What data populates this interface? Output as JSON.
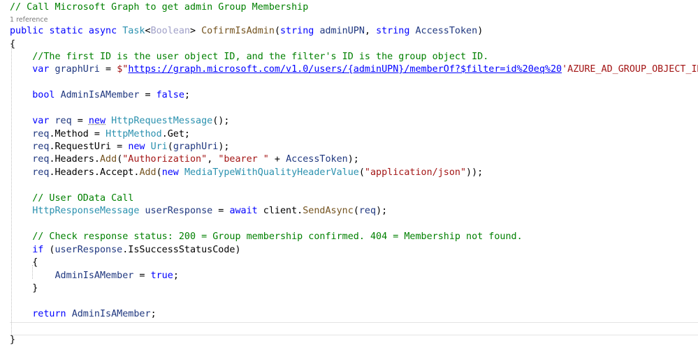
{
  "editor": {
    "codelens": "1 reference",
    "lines": [
      [
        {
          "t": "// Call Microsoft Graph to get admin Group Membership",
          "c": "cm"
        }
      ],
      [
        {
          "t": "public",
          "c": "kw"
        },
        {
          "t": " ",
          "c": "pn"
        },
        {
          "t": "static",
          "c": "kw"
        },
        {
          "t": " ",
          "c": "pn"
        },
        {
          "t": "async",
          "c": "kw"
        },
        {
          "t": " ",
          "c": "pn"
        },
        {
          "t": "Task",
          "c": "ty"
        },
        {
          "t": "<",
          "c": "pn"
        },
        {
          "t": "Boolean",
          "c": "tp"
        },
        {
          "t": "> ",
          "c": "pn"
        },
        {
          "t": "CofirmIsAdmin",
          "c": "mt"
        },
        {
          "t": "(",
          "c": "pn"
        },
        {
          "t": "string",
          "c": "kw"
        },
        {
          "t": " ",
          "c": "pn"
        },
        {
          "t": "adminUPN",
          "c": "vr"
        },
        {
          "t": ", ",
          "c": "pn"
        },
        {
          "t": "string",
          "c": "kw"
        },
        {
          "t": " ",
          "c": "pn"
        },
        {
          "t": "AccessToken",
          "c": "vr"
        },
        {
          "t": ")",
          "c": "pn"
        }
      ],
      [
        {
          "t": "{",
          "c": "pn"
        }
      ],
      [
        {
          "t": "    ",
          "c": "pn"
        },
        {
          "t": "//The first ID is the user object ID, and the filter's ID is the group object ID.",
          "c": "cm"
        }
      ],
      [
        {
          "t": "    ",
          "c": "pn"
        },
        {
          "t": "var",
          "c": "kw"
        },
        {
          "t": " ",
          "c": "pn"
        },
        {
          "t": "graphUri",
          "c": "vr"
        },
        {
          "t": " = ",
          "c": "pn"
        },
        {
          "t": "$\"",
          "c": "st"
        },
        {
          "t": "https://graph.microsoft.com/v1.0/users/{adminUPN}/memberOf?$filter=id%20eq%20",
          "c": "url"
        },
        {
          "t": "'AZURE_AD_GROUP_OBJECT_ID'\"",
          "c": "st"
        },
        {
          "t": ";",
          "c": "pn"
        }
      ],
      [],
      [
        {
          "t": "    ",
          "c": "pn"
        },
        {
          "t": "bool",
          "c": "kw"
        },
        {
          "t": " ",
          "c": "pn"
        },
        {
          "t": "AdminIsAMember",
          "c": "vr"
        },
        {
          "t": " = ",
          "c": "pn"
        },
        {
          "t": "false",
          "c": "kw"
        },
        {
          "t": ";",
          "c": "pn"
        }
      ],
      [],
      [
        {
          "t": "    ",
          "c": "pn"
        },
        {
          "t": "var",
          "c": "kw"
        },
        {
          "t": " ",
          "c": "pn"
        },
        {
          "t": "req",
          "c": "vr"
        },
        {
          "t": " = ",
          "c": "pn"
        },
        {
          "t": "new",
          "c": "kw squig"
        },
        {
          "t": " ",
          "c": "pn"
        },
        {
          "t": "HttpRequestMessage",
          "c": "ty"
        },
        {
          "t": "();",
          "c": "pn"
        }
      ],
      [
        {
          "t": "    ",
          "c": "pn"
        },
        {
          "t": "req",
          "c": "vr"
        },
        {
          "t": ".Method = ",
          "c": "pn"
        },
        {
          "t": "HttpMethod",
          "c": "ty"
        },
        {
          "t": ".Get;",
          "c": "pn"
        }
      ],
      [
        {
          "t": "    ",
          "c": "pn"
        },
        {
          "t": "req",
          "c": "vr"
        },
        {
          "t": ".RequestUri = ",
          "c": "pn"
        },
        {
          "t": "new",
          "c": "kw"
        },
        {
          "t": " ",
          "c": "pn"
        },
        {
          "t": "Uri",
          "c": "ty"
        },
        {
          "t": "(",
          "c": "pn"
        },
        {
          "t": "graphUri",
          "c": "vr"
        },
        {
          "t": ");",
          "c": "pn"
        }
      ],
      [
        {
          "t": "    ",
          "c": "pn"
        },
        {
          "t": "req",
          "c": "vr"
        },
        {
          "t": ".Headers.",
          "c": "pn"
        },
        {
          "t": "Add",
          "c": "mt"
        },
        {
          "t": "(",
          "c": "pn"
        },
        {
          "t": "\"Authorization\"",
          "c": "st"
        },
        {
          "t": ", ",
          "c": "pn"
        },
        {
          "t": "\"bearer \"",
          "c": "st"
        },
        {
          "t": " + ",
          "c": "pn"
        },
        {
          "t": "AccessToken",
          "c": "vr"
        },
        {
          "t": ");",
          "c": "pn"
        }
      ],
      [
        {
          "t": "    ",
          "c": "pn"
        },
        {
          "t": "req",
          "c": "vr"
        },
        {
          "t": ".Headers.Accept.",
          "c": "pn"
        },
        {
          "t": "Add",
          "c": "mt"
        },
        {
          "t": "(",
          "c": "pn"
        },
        {
          "t": "new",
          "c": "kw"
        },
        {
          "t": " ",
          "c": "pn"
        },
        {
          "t": "MediaTypeWithQualityHeaderValue",
          "c": "ty"
        },
        {
          "t": "(",
          "c": "pn"
        },
        {
          "t": "\"application/json\"",
          "c": "st"
        },
        {
          "t": "));",
          "c": "pn"
        }
      ],
      [],
      [
        {
          "t": "    ",
          "c": "pn"
        },
        {
          "t": "// User OData Call",
          "c": "cm"
        }
      ],
      [
        {
          "t": "    ",
          "c": "pn"
        },
        {
          "t": "HttpResponseMessage",
          "c": "ty"
        },
        {
          "t": " ",
          "c": "pn"
        },
        {
          "t": "userResponse",
          "c": "vr"
        },
        {
          "t": " = ",
          "c": "pn"
        },
        {
          "t": "await",
          "c": "kw"
        },
        {
          "t": " client.",
          "c": "pn"
        },
        {
          "t": "SendAsync",
          "c": "mt"
        },
        {
          "t": "(",
          "c": "pn"
        },
        {
          "t": "req",
          "c": "vr"
        },
        {
          "t": ");",
          "c": "pn"
        }
      ],
      [],
      [
        {
          "t": "    ",
          "c": "pn"
        },
        {
          "t": "// Check response status: 200 = Group membership confirmed. 404 = Membership not found.",
          "c": "cm"
        }
      ],
      [
        {
          "t": "    ",
          "c": "pn"
        },
        {
          "t": "if",
          "c": "kw"
        },
        {
          "t": " (",
          "c": "pn"
        },
        {
          "t": "userResponse",
          "c": "vr"
        },
        {
          "t": ".IsSuccessStatusCode)",
          "c": "pn"
        }
      ],
      [
        {
          "t": "    {",
          "c": "pn"
        }
      ],
      [
        {
          "t": "        ",
          "c": "pn"
        },
        {
          "t": "AdminIsAMember",
          "c": "vr"
        },
        {
          "t": " = ",
          "c": "pn"
        },
        {
          "t": "true",
          "c": "kw"
        },
        {
          "t": ";",
          "c": "pn"
        }
      ],
      [
        {
          "t": "    }",
          "c": "pn"
        }
      ],
      [],
      [
        {
          "t": "    ",
          "c": "pn"
        },
        {
          "t": "return",
          "c": "kw"
        },
        {
          "t": " ",
          "c": "pn"
        },
        {
          "t": "AdminIsAMember",
          "c": "vr"
        },
        {
          "t": ";",
          "c": "pn"
        }
      ],
      [],
      [
        {
          "t": "}",
          "c": "pn"
        }
      ]
    ]
  }
}
